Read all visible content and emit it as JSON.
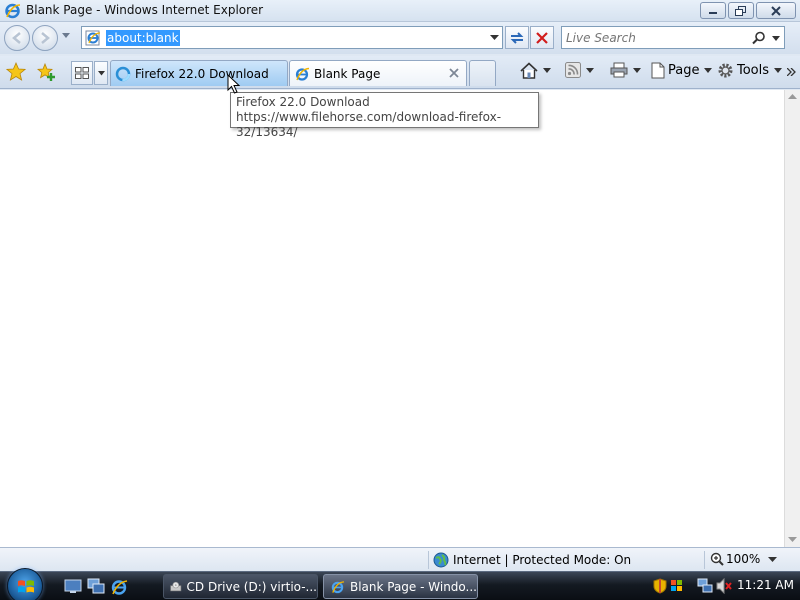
{
  "window": {
    "title": "Blank Page - Windows Internet Explorer"
  },
  "address_bar": {
    "url": "about:blank"
  },
  "search": {
    "placeholder": "Live Search"
  },
  "tabs": [
    {
      "label": "Firefox 22.0 Download",
      "state": "loading-hover"
    },
    {
      "label": "Blank Page",
      "state": "active"
    }
  ],
  "command_bar": {
    "page_label": "Page",
    "tools_label": "Tools"
  },
  "tooltip": {
    "title": "Firefox 22.0 Download",
    "url": "https://www.filehorse.com/download-firefox-32/13634/"
  },
  "status_bar": {
    "zone": "Internet | Protected Mode: On",
    "zoom": "100%"
  },
  "taskbar": {
    "buttons": [
      {
        "label": "CD Drive (D:) virtio-..."
      },
      {
        "label": "Blank Page - Windo..."
      }
    ],
    "clock": "11:21 AM"
  },
  "colors": {
    "selection": "#3399ff",
    "chrome_light": "#e6eef8",
    "chrome_dark": "#d3dfee",
    "taskbar": "#141a22"
  }
}
